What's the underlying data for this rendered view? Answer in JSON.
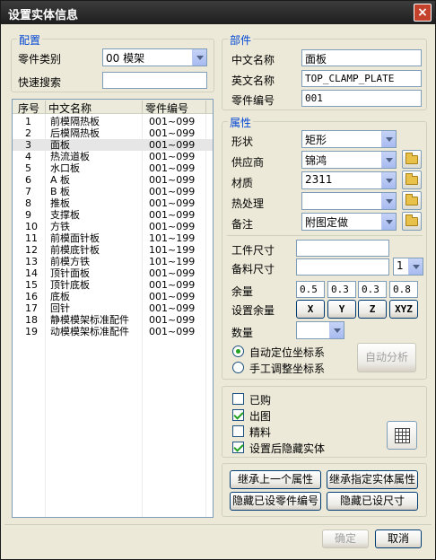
{
  "window": {
    "title": "设置实体信息",
    "close_label": "×"
  },
  "config": {
    "group_label": "配置",
    "category_label": "零件类别",
    "category_value": "00 模架",
    "search_label": "快速搜索",
    "search_value": ""
  },
  "list": {
    "columns": [
      "序号",
      "中文名称",
      "零件编号"
    ],
    "rows": [
      {
        "no": "1",
        "name": "前模隔热板",
        "code": "001~099"
      },
      {
        "no": "2",
        "name": "后模隔热板",
        "code": "001~099"
      },
      {
        "no": "3",
        "name": "面板",
        "code": "001~099",
        "selected": true
      },
      {
        "no": "4",
        "name": "热流道板",
        "code": "001~099"
      },
      {
        "no": "5",
        "name": "水口板",
        "code": "001~099"
      },
      {
        "no": "6",
        "name": "A 板",
        "code": "001~099"
      },
      {
        "no": "7",
        "name": "B 板",
        "code": "001~099"
      },
      {
        "no": "8",
        "name": "推板",
        "code": "001~099"
      },
      {
        "no": "9",
        "name": "支撑板",
        "code": "001~099"
      },
      {
        "no": "10",
        "name": "方铁",
        "code": "001~099"
      },
      {
        "no": "11",
        "name": "前模面针板",
        "code": "101~199"
      },
      {
        "no": "12",
        "name": "前模底针板",
        "code": "101~199"
      },
      {
        "no": "13",
        "name": "前模方铁",
        "code": "101~199"
      },
      {
        "no": "14",
        "name": "顶针面板",
        "code": "001~099"
      },
      {
        "no": "15",
        "name": "顶针底板",
        "code": "001~099"
      },
      {
        "no": "16",
        "name": "底板",
        "code": "001~099"
      },
      {
        "no": "17",
        "name": "回针",
        "code": "001~099"
      },
      {
        "no": "18",
        "name": "静模模架标准配件",
        "code": "001~099"
      },
      {
        "no": "19",
        "name": "动模模架标准配件",
        "code": "001~099"
      }
    ]
  },
  "part": {
    "group_label": "部件",
    "cn_name_label": "中文名称",
    "cn_name_value": "面板",
    "en_name_label": "英文名称",
    "en_name_value": "TOP_CLAMP_PLATE",
    "code_label": "零件编号",
    "code_value": "001"
  },
  "attr": {
    "group_label": "属性",
    "shape_label": "形状",
    "shape_value": "矩形",
    "supplier_label": "供应商",
    "supplier_value": "锦鸿",
    "material_label": "材质",
    "material_value": "2311",
    "heat_label": "热处理",
    "heat_value": "",
    "remark_label": "备注",
    "remark_value": "附图定做",
    "work_size_label": "工件尺寸",
    "work_size_value": "",
    "stock_size_label": "备料尺寸",
    "stock_size_value": "",
    "stock_count": "1",
    "allowance_label": "余量",
    "allowance_values": [
      "0.5",
      "0.3",
      "0.3",
      "0.8"
    ],
    "set_allowance_label": "设置余量",
    "axis_buttons": [
      "X",
      "Y",
      "Z",
      "XYZ"
    ],
    "qty_label": "数量",
    "qty_value": "",
    "radio_auto": "自动定位坐标系",
    "radio_manual": "手工调整坐标系",
    "auto_analyze": "自动分析"
  },
  "flags": {
    "purchased": "已购",
    "drawing": "出图",
    "precision": "精料",
    "hide_after": "设置后隐藏实体"
  },
  "actions": {
    "inherit_prev": "继承上一个属性",
    "inherit_spec": "继承指定实体属性",
    "hide_code": "隐藏已设零件编号",
    "hide_size": "隐藏已设尺寸"
  },
  "footer": {
    "ok": "确定",
    "cancel": "取消"
  }
}
